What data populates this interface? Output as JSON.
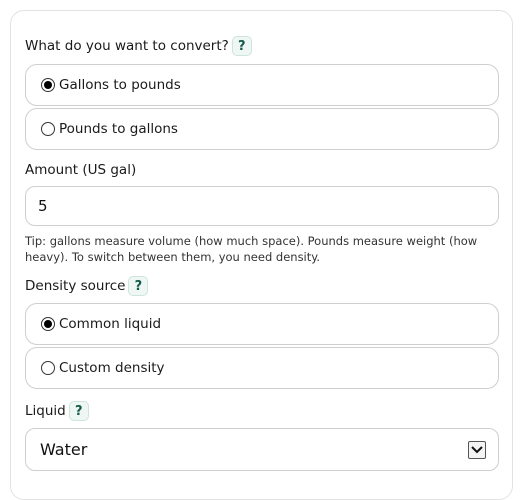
{
  "convert": {
    "question": "What do you want to convert?",
    "help_glyph": "?",
    "options": [
      {
        "label": "Gallons to pounds",
        "selected": true
      },
      {
        "label": "Pounds to gallons",
        "selected": false
      }
    ]
  },
  "amount": {
    "label": "Amount (US gal)",
    "value": "5"
  },
  "tip": "Tip: gallons measure volume (how much space). Pounds measure weight (how heavy). To switch between them, you need density.",
  "density": {
    "label": "Density source",
    "help_glyph": "?",
    "options": [
      {
        "label": "Common liquid",
        "selected": true
      },
      {
        "label": "Custom density",
        "selected": false
      }
    ]
  },
  "liquid": {
    "label": "Liquid",
    "help_glyph": "?",
    "selected": "Water"
  },
  "icons": {
    "help": "help-question-icon",
    "dropdown": "chevron-down-icon"
  },
  "colors": {
    "help_bg": "#eef7f3",
    "help_fg": "#145a4a",
    "border": "#cfcfcf"
  }
}
